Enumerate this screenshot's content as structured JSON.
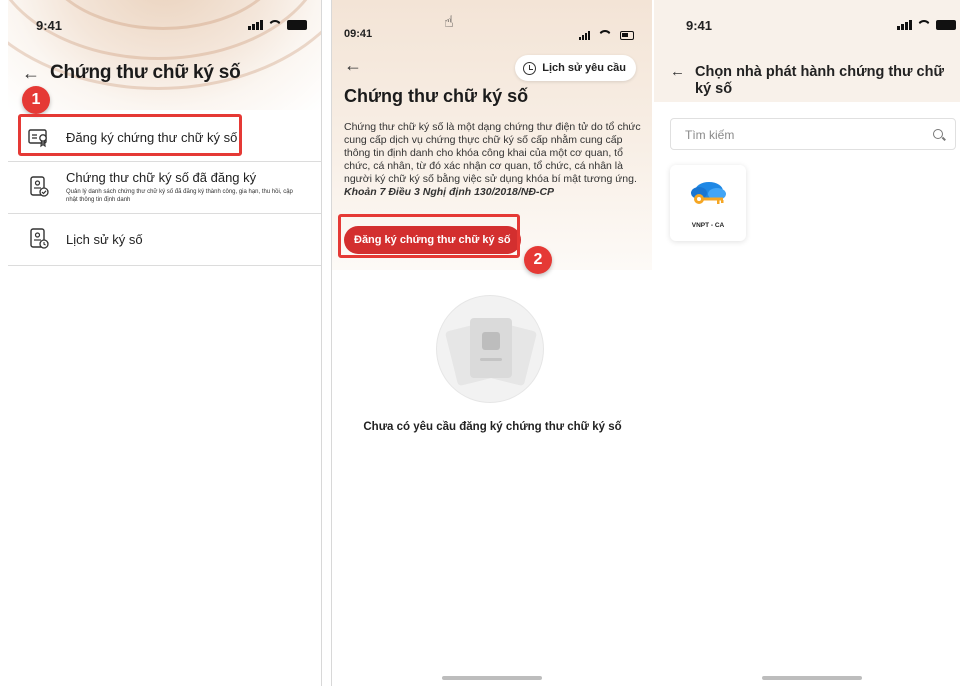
{
  "screen1": {
    "status_time": "9:41",
    "title": "Chứng thư chữ ký số",
    "step_badge": "1",
    "menu": [
      {
        "label": "Đăng ký chứng thư chữ ký số",
        "icon": "certificate-icon"
      },
      {
        "label": "Chứng thư chữ ký số đã đăng ký",
        "subtitle": "Quản lý danh sách chứng thư chữ ký số đã đăng ký thành công, gia hạn, thu hồi, cập nhật thông tin định danh",
        "icon": "document-check-icon"
      },
      {
        "label": "Lịch sử ký số",
        "icon": "document-history-icon"
      }
    ]
  },
  "screen2": {
    "status_time": "09:41",
    "history_button": "Lịch sử yêu cầu",
    "title": "Chứng thư chữ ký số",
    "description": "Chứng thư chữ ký số là một dạng chứng thư điện tử do tổ chức cung cấp dịch vụ chứng thực chữ ký số cấp nhằm cung cấp thông tin định danh cho khóa công khai của một cơ quan, tổ chức, cá nhân, từ đó xác nhận cơ quan, tổ chức, cá nhân là người ký chữ ký số bằng việc sử dụng khóa bí mật tương ứng.",
    "legal_ref": "Khoản 7 Điều 3 Nghị định 130/2018/NĐ-CP",
    "register_button": "Đăng ký chứng thư chữ ký số",
    "step_badge": "2",
    "empty_text": "Chưa có yêu cầu đăng ký chứng thư chữ ký số"
  },
  "screen3": {
    "status_time": "9:41",
    "title": "Chọn nhà phát hành chứng thư chữ ký số",
    "search_placeholder": "Tìm kiếm",
    "issuers": [
      {
        "name": "VNPT - CA",
        "icon": "vnpt-ca-logo"
      }
    ]
  },
  "colors": {
    "accent_red": "#d32f2f",
    "highlight_red": "#e53935",
    "header_beige": "#f3e4d6"
  }
}
